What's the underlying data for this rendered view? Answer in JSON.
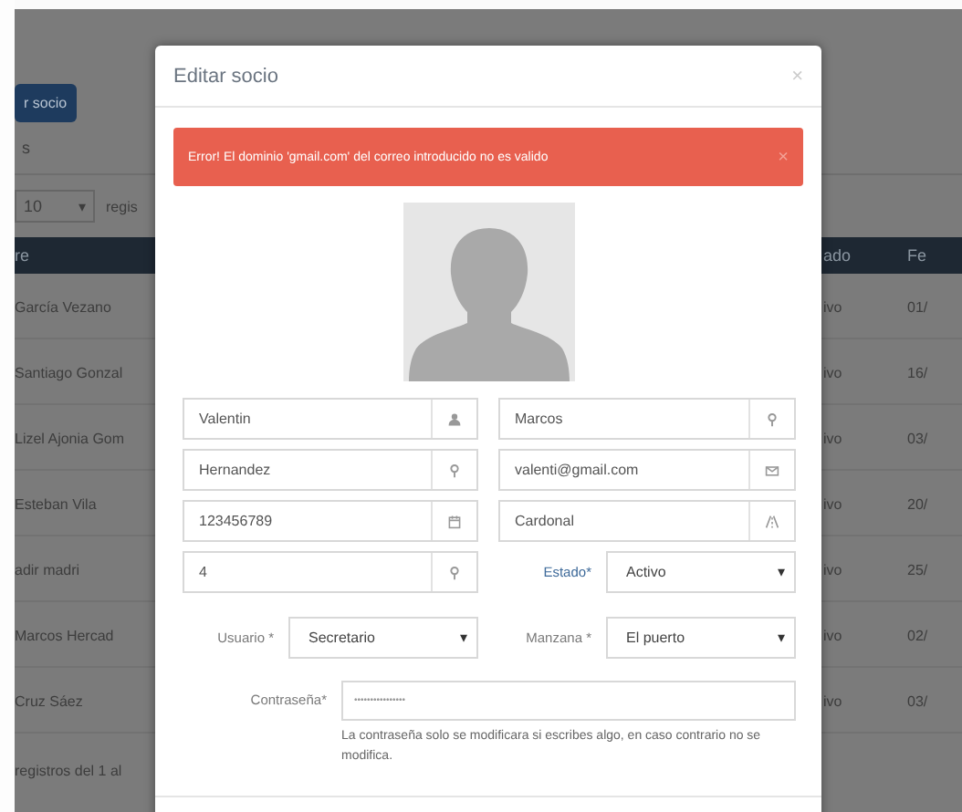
{
  "background": {
    "add_button": "r socio",
    "section_label": "s",
    "page_size": "10",
    "page_size_caret": "▾",
    "page_size_label": "regis",
    "table": {
      "columns": [
        {
          "label": "re"
        },
        {
          "label": "ado"
        },
        {
          "label": "Fe"
        }
      ],
      "rows": [
        {
          "cells": [
            "García Vezano",
            "ivo",
            "01/"
          ]
        },
        {
          "cells": [
            "Santiago Gonzal",
            "ivo",
            "16/"
          ]
        },
        {
          "cells": [
            "Lizel Ajonia Gom",
            "ivo",
            "03/"
          ]
        },
        {
          "cells": [
            "Esteban Vila",
            "ivo",
            "20/"
          ]
        },
        {
          "cells": [
            "adir madri",
            "ivo",
            "25/"
          ]
        },
        {
          "cells": [
            "Marcos Hercad",
            "ivo",
            "02/"
          ]
        },
        {
          "cells": [
            "Cruz Sáez",
            "ivo",
            "03/"
          ]
        }
      ]
    },
    "footer": "registros del 1 al"
  },
  "modal": {
    "title": "Editar socio",
    "close": "×",
    "alert": {
      "text": "Error! El dominio 'gmail.com' del correo introducido no es valido",
      "close": "×"
    },
    "rows": [
      [
        {
          "kind": "input",
          "value": "Valentin"
        },
        {
          "kind": "input",
          "value": "Marcos"
        }
      ],
      [
        {
          "kind": "input",
          "value": "Hernandez"
        },
        {
          "kind": "input",
          "value": "valenti@gmail.com"
        }
      ],
      [
        {
          "kind": "input",
          "value": "123456789"
        },
        {
          "kind": "input",
          "value": "Cardonal"
        }
      ],
      [
        {
          "kind": "input",
          "value": "4"
        },
        {
          "kind": "select",
          "label": "Estado*",
          "value": "Activo",
          "caret": "▾",
          "highlighted": true
        }
      ],
      [
        {
          "kind": "select",
          "label": "Usuario *",
          "value": "Secretario",
          "caret": "▾",
          "highlighted": false
        },
        {
          "kind": "select",
          "label": "Manzana *",
          "value": "El puerto",
          "caret": "▾",
          "highlighted": false
        }
      ]
    ],
    "password": {
      "label": "Contraseña*",
      "placeholder": "••••••••••••••••",
      "help": "La contraseña solo se modificara si escribes algo, en caso contrario no se modifica."
    }
  }
}
